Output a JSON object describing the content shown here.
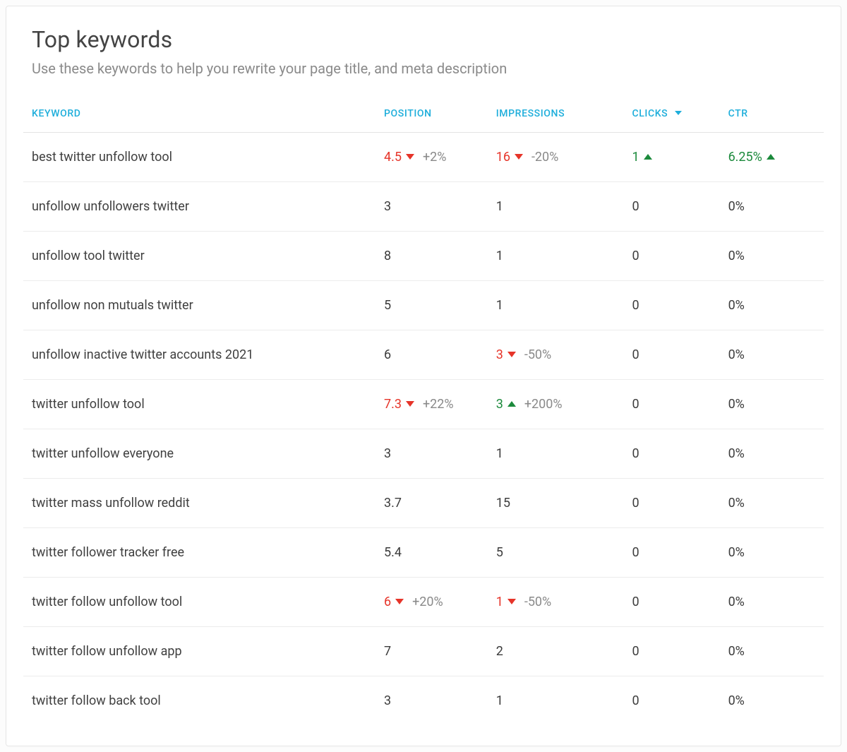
{
  "header": {
    "title": "Top keywords",
    "subtitle": "Use these keywords to help you rewrite your page title, and meta description"
  },
  "columns": {
    "keyword": "KEYWORD",
    "position": "POSITION",
    "impressions": "IMPRESSIONS",
    "clicks": "CLICKS",
    "ctr": "CTR"
  },
  "sort": {
    "column": "clicks",
    "direction": "desc"
  },
  "rows": [
    {
      "keyword": "best twitter unfollow tool",
      "position": {
        "value": "4.5",
        "trend": "down-red",
        "delta": "+2%"
      },
      "impressions": {
        "value": "16",
        "trend": "down-red",
        "delta": "-20%"
      },
      "clicks": {
        "value": "1",
        "trend": "up-green",
        "delta": ""
      },
      "ctr": {
        "value": "6.25%",
        "trend": "up-green",
        "delta": ""
      }
    },
    {
      "keyword": "unfollow unfollowers twitter",
      "position": {
        "value": "3",
        "trend": "",
        "delta": ""
      },
      "impressions": {
        "value": "1",
        "trend": "",
        "delta": ""
      },
      "clicks": {
        "value": "0",
        "trend": "",
        "delta": ""
      },
      "ctr": {
        "value": "0%",
        "trend": "",
        "delta": ""
      }
    },
    {
      "keyword": "unfollow tool twitter",
      "position": {
        "value": "8",
        "trend": "",
        "delta": ""
      },
      "impressions": {
        "value": "1",
        "trend": "",
        "delta": ""
      },
      "clicks": {
        "value": "0",
        "trend": "",
        "delta": ""
      },
      "ctr": {
        "value": "0%",
        "trend": "",
        "delta": ""
      }
    },
    {
      "keyword": "unfollow non mutuals twitter",
      "position": {
        "value": "5",
        "trend": "",
        "delta": ""
      },
      "impressions": {
        "value": "1",
        "trend": "",
        "delta": ""
      },
      "clicks": {
        "value": "0",
        "trend": "",
        "delta": ""
      },
      "ctr": {
        "value": "0%",
        "trend": "",
        "delta": ""
      }
    },
    {
      "keyword": "unfollow inactive twitter accounts 2021",
      "position": {
        "value": "6",
        "trend": "",
        "delta": ""
      },
      "impressions": {
        "value": "3",
        "trend": "down-red",
        "delta": "-50%"
      },
      "clicks": {
        "value": "0",
        "trend": "",
        "delta": ""
      },
      "ctr": {
        "value": "0%",
        "trend": "",
        "delta": ""
      }
    },
    {
      "keyword": "twitter unfollow tool",
      "position": {
        "value": "7.3",
        "trend": "down-red",
        "delta": "+22%"
      },
      "impressions": {
        "value": "3",
        "trend": "up-green",
        "delta": "+200%"
      },
      "clicks": {
        "value": "0",
        "trend": "",
        "delta": ""
      },
      "ctr": {
        "value": "0%",
        "trend": "",
        "delta": ""
      }
    },
    {
      "keyword": "twitter unfollow everyone",
      "position": {
        "value": "3",
        "trend": "",
        "delta": ""
      },
      "impressions": {
        "value": "1",
        "trend": "",
        "delta": ""
      },
      "clicks": {
        "value": "0",
        "trend": "",
        "delta": ""
      },
      "ctr": {
        "value": "0%",
        "trend": "",
        "delta": ""
      }
    },
    {
      "keyword": "twitter mass unfollow reddit",
      "position": {
        "value": "3.7",
        "trend": "",
        "delta": ""
      },
      "impressions": {
        "value": "15",
        "trend": "",
        "delta": ""
      },
      "clicks": {
        "value": "0",
        "trend": "",
        "delta": ""
      },
      "ctr": {
        "value": "0%",
        "trend": "",
        "delta": ""
      }
    },
    {
      "keyword": "twitter follower tracker free",
      "position": {
        "value": "5.4",
        "trend": "",
        "delta": ""
      },
      "impressions": {
        "value": "5",
        "trend": "",
        "delta": ""
      },
      "clicks": {
        "value": "0",
        "trend": "",
        "delta": ""
      },
      "ctr": {
        "value": "0%",
        "trend": "",
        "delta": ""
      }
    },
    {
      "keyword": "twitter follow unfollow tool",
      "position": {
        "value": "6",
        "trend": "down-red",
        "delta": "+20%"
      },
      "impressions": {
        "value": "1",
        "trend": "down-red",
        "delta": "-50%"
      },
      "clicks": {
        "value": "0",
        "trend": "",
        "delta": ""
      },
      "ctr": {
        "value": "0%",
        "trend": "",
        "delta": ""
      }
    },
    {
      "keyword": "twitter follow unfollow app",
      "position": {
        "value": "7",
        "trend": "",
        "delta": ""
      },
      "impressions": {
        "value": "2",
        "trend": "",
        "delta": ""
      },
      "clicks": {
        "value": "0",
        "trend": "",
        "delta": ""
      },
      "ctr": {
        "value": "0%",
        "trend": "",
        "delta": ""
      }
    },
    {
      "keyword": "twitter follow back tool",
      "position": {
        "value": "3",
        "trend": "",
        "delta": ""
      },
      "impressions": {
        "value": "1",
        "trend": "",
        "delta": ""
      },
      "clicks": {
        "value": "0",
        "trend": "",
        "delta": ""
      },
      "ctr": {
        "value": "0%",
        "trend": "",
        "delta": ""
      }
    }
  ]
}
